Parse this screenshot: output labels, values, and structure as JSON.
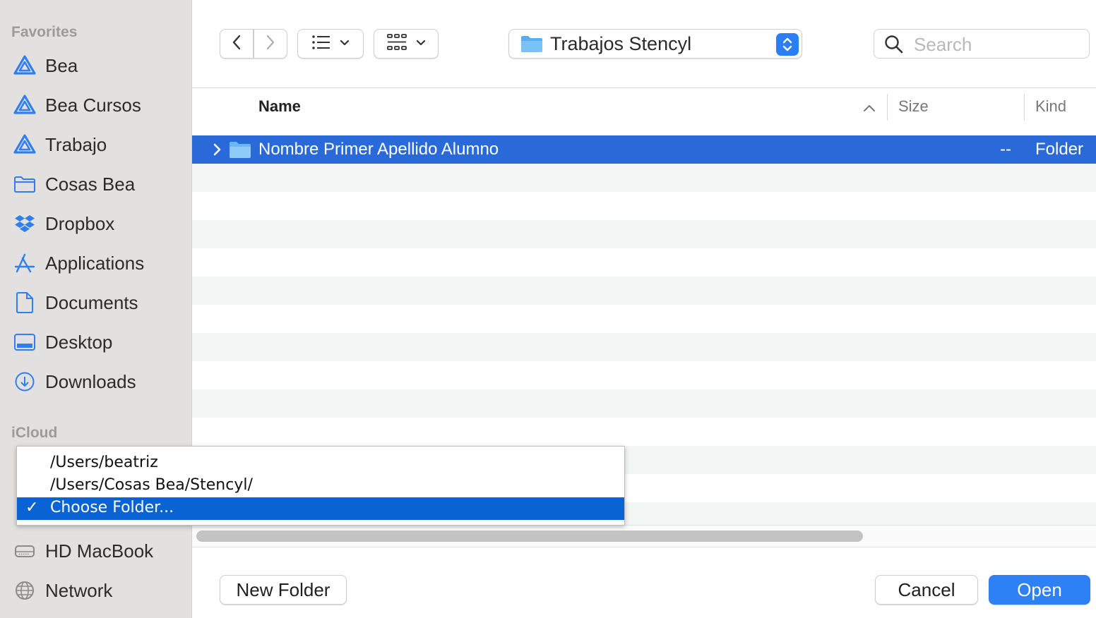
{
  "sidebar": {
    "favorites_title": "Favorites",
    "icloud_title": "iCloud",
    "items": [
      {
        "label": "Bea",
        "icon": "google-drive-icon"
      },
      {
        "label": "Bea Cursos",
        "icon": "google-drive-icon"
      },
      {
        "label": "Trabajo",
        "icon": "google-drive-icon"
      },
      {
        "label": "Cosas Bea",
        "icon": "folder-icon"
      },
      {
        "label": "Dropbox",
        "icon": "dropbox-icon"
      },
      {
        "label": "Applications",
        "icon": "applications-icon"
      },
      {
        "label": "Documents",
        "icon": "document-icon"
      },
      {
        "label": "Desktop",
        "icon": "desktop-icon"
      },
      {
        "label": "Downloads",
        "icon": "downloads-icon"
      }
    ],
    "locations": [
      {
        "label": "HD MacBook",
        "icon": "hard-drive-icon"
      },
      {
        "label": "Network",
        "icon": "network-icon"
      }
    ]
  },
  "toolbar": {
    "path_label": "Trabajos Stencyl",
    "search_placeholder": "Search"
  },
  "table": {
    "columns": {
      "name": "Name",
      "size": "Size",
      "kind": "Kind"
    },
    "rows": [
      {
        "name": "Nombre Primer Apellido Alumno",
        "size": "--",
        "kind": "Folder",
        "selected": true
      }
    ]
  },
  "buttons": {
    "new_folder": "New Folder",
    "cancel": "Cancel",
    "open": "Open"
  },
  "popup_menu": {
    "items": [
      {
        "label": "/Users/beatriz",
        "checked": false
      },
      {
        "label": "/Users/Cosas Bea/Stencyl/",
        "checked": false
      },
      {
        "label": "Choose Folder...",
        "checked": true
      }
    ],
    "check_mark": "✓"
  },
  "colors": {
    "accent": "#2e80f5",
    "selection": "#2a69d8",
    "menu_selection": "#0a63d2",
    "sidebar_bg": "#e3e1df",
    "sidebar_icon": "#2f7ff0"
  }
}
